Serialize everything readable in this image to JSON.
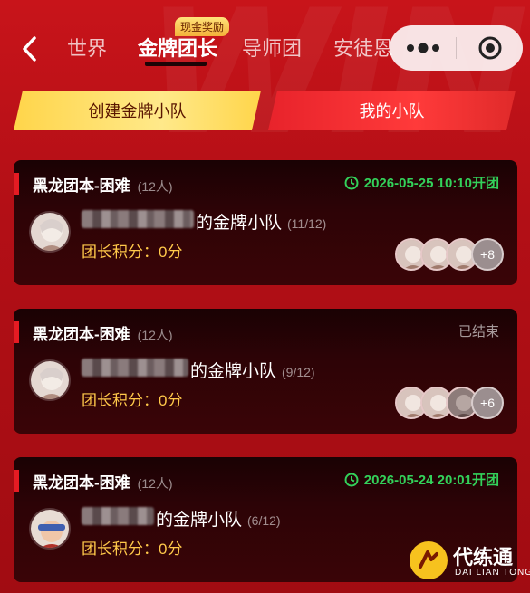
{
  "header": {
    "tabs": [
      {
        "label": "世界"
      },
      {
        "label": "金牌团长"
      },
      {
        "label": "导师团"
      },
      {
        "label": "安徒恩"
      }
    ],
    "badge": "现金奖励",
    "capsule_more": "more-dots-icon",
    "capsule_close": "target-close-icon"
  },
  "actions": {
    "create_label": "创建金牌小队",
    "my_label": "我的小队"
  },
  "cards": [
    {
      "dungeon": "黑龙团本-困难",
      "capacity": "(12人)",
      "status": "2026-05-25 10:10开团",
      "status_type": "open",
      "team_suffix": "的金牌小队",
      "slots": "(11/12)",
      "score_label": "团长积分：0分",
      "extra_members": "+8"
    },
    {
      "dungeon": "黑龙团本-困难",
      "capacity": "(12人)",
      "status": "已结束",
      "status_type": "ended",
      "team_suffix": "的金牌小队",
      "slots": "(9/12)",
      "score_label": "团长积分：0分",
      "extra_members": "+6"
    },
    {
      "dungeon": "黑龙团本-困难",
      "capacity": "(12人)",
      "status": "2026-05-24 20:01开团",
      "status_type": "open",
      "team_suffix": "的金牌小队",
      "slots": "(6/12)",
      "score_label": "团长积分：0分",
      "extra_members": ""
    }
  ],
  "watermark": {
    "title": "代练通",
    "subtitle": "DAI LIAN TONG"
  },
  "colors": {
    "background": "#b30f16",
    "gold": "#ffd54a",
    "open_green": "#33d15a",
    "score_gold": "#ffc94a"
  }
}
